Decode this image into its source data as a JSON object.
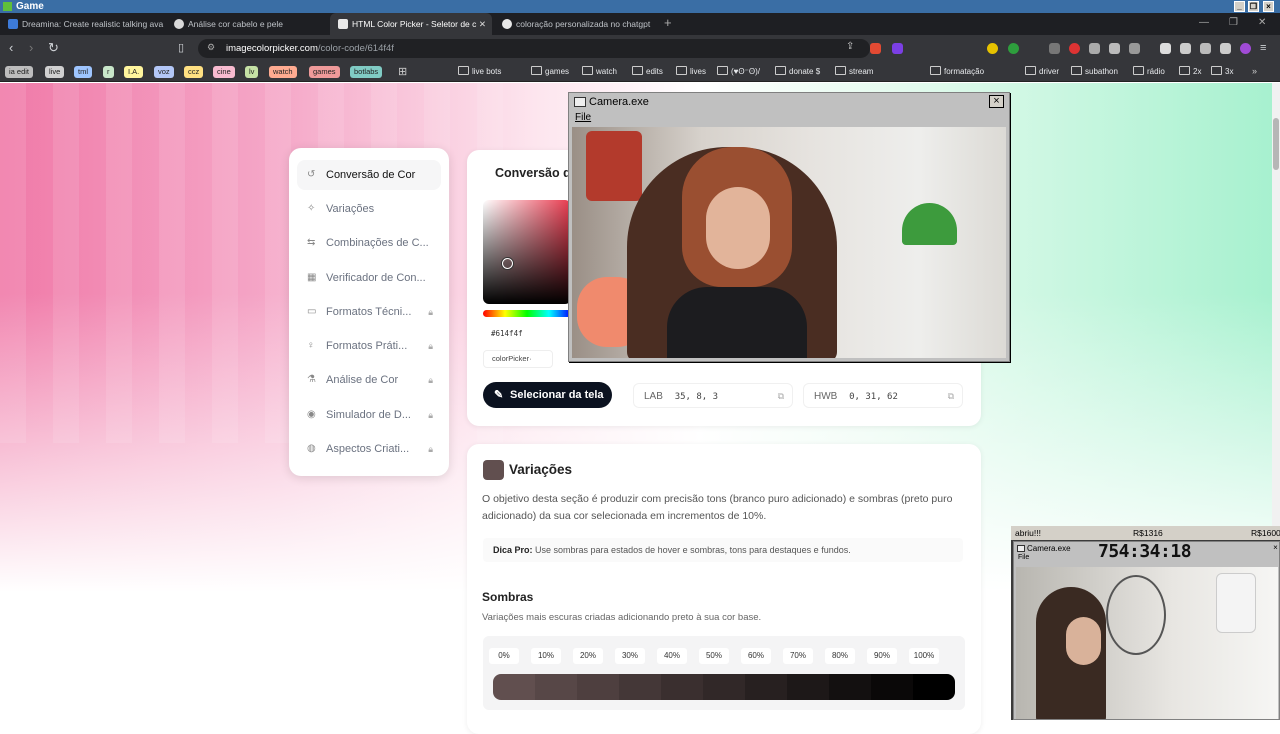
{
  "window": {
    "title": "Game"
  },
  "tabs": [
    {
      "label": "Dreamina: Create realistic talking ava",
      "color": "#3d7bd9"
    },
    {
      "label": "Análise cor cabelo e pele",
      "color": "#d9d9d9"
    },
    {
      "label": "HTML Color Picker - Seletor de c",
      "color": "#e9e9e9",
      "active": true
    },
    {
      "label": "coloração personalizada no chatgpt",
      "color": "#e8e8e8"
    }
  ],
  "address": {
    "domain": "imagecolorpicker.com",
    "path": "/color-code/614f4f"
  },
  "bookmarks": [
    {
      "label": "ia edit",
      "color": "#bdbdbd"
    },
    {
      "label": "live",
      "color": "#d0d0d0"
    },
    {
      "label": "tml",
      "color": "#9ec5fe"
    },
    {
      "label": "r",
      "color": "#c8e6c9"
    },
    {
      "label": "I.A.",
      "color": "#fff59d"
    },
    {
      "label": "voz",
      "color": "#b3c7f7"
    },
    {
      "label": "ccz",
      "color": "#ffe082"
    },
    {
      "label": "cine",
      "color": "#f8bbd0"
    },
    {
      "label": "lv",
      "color": "#c5e1a5"
    },
    {
      "label": "watch",
      "color": "#ffab91"
    },
    {
      "label": "games",
      "color": "#ef9a9a"
    },
    {
      "label": "botlabs",
      "color": "#80cbc4"
    }
  ],
  "bookmark_folders": [
    "live bots",
    "games",
    "watch",
    "edits",
    "lives",
    "(♥ʘ⁻ʘ)/",
    "donate $",
    "stream",
    "formatação",
    "driver",
    "subathon",
    "rádio",
    "2x",
    "3x"
  ],
  "sidebar": {
    "items": [
      {
        "label": "Conversão de Cor",
        "icon": "refresh-icon",
        "locked": false
      },
      {
        "label": "Variações",
        "icon": "sparkle-icon",
        "locked": false
      },
      {
        "label": "Combinações de C...",
        "icon": "shuffle-icon",
        "locked": false
      },
      {
        "label": "Verificador de Con...",
        "icon": "grid-icon",
        "locked": false
      },
      {
        "label": "Formatos Técni...",
        "icon": "monitor-icon",
        "locked": true
      },
      {
        "label": "Formatos Práti...",
        "icon": "bulb-icon",
        "locked": true
      },
      {
        "label": "Análise de Cor",
        "icon": "flask-icon",
        "locked": true
      },
      {
        "label": "Simulador de D...",
        "icon": "eye-icon",
        "locked": true
      },
      {
        "label": "Aspectos Criati...",
        "icon": "palette-icon",
        "locked": true
      }
    ]
  },
  "converter": {
    "title": "Conversão d",
    "hex_value": "#614f4f",
    "picker_label": "colorPicker·",
    "select_button": "Selecionar da tela",
    "values": [
      {
        "label": "LAB",
        "value": "35, 8, 3"
      },
      {
        "label": "HWB",
        "value": "0, 31, 62"
      }
    ]
  },
  "variations": {
    "title": "Variações",
    "description": "O objetivo desta seção é produzir com precisão tons (branco puro adicionado) e sombras (preto puro adicionado) da sua cor selecionada em incrementos de 10%.",
    "tip_label": "Dica Pro:",
    "tip_text": "Use sombras para estados de hover e sombras, tons para destaques e fundos.",
    "shades_title": "Sombras",
    "shades_description": "Variações mais escuras criadas adicionando preto à sua cor base.",
    "percentages": [
      "0%",
      "10%",
      "20%",
      "30%",
      "40%",
      "50%",
      "60%",
      "70%",
      "80%",
      "90%",
      "100%"
    ],
    "shade_colors": [
      "#614f4f",
      "#574747",
      "#4e3f3f",
      "#443737",
      "#3a2f2f",
      "#312828",
      "#272020",
      "#1d1818",
      "#131010",
      "#0a0808",
      "#000000"
    ]
  },
  "camera_main": {
    "title": "Camera.exe",
    "menu": "File"
  },
  "stream_overlay": {
    "left_text": "abriu!!!",
    "mid_text": "R$1316",
    "right_text": "R$1600",
    "cam_title": "Camera.exe",
    "menu": "File",
    "timer": "754:34:18"
  },
  "colors": {
    "base": "#614f4f"
  }
}
